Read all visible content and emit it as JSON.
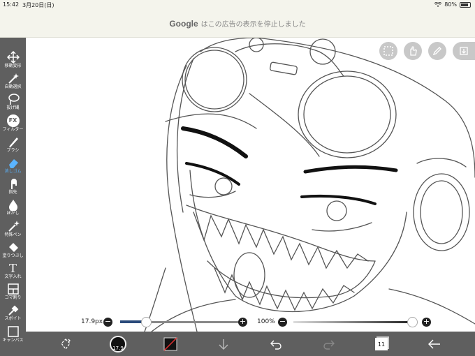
{
  "status_bar": {
    "time": "15:42",
    "date": "3月20日(日)",
    "battery": "80%",
    "battery_level": 0.8
  },
  "ad_banner": {
    "brand": "Google",
    "message": "はこの広告の表示を停止しました"
  },
  "tools": [
    {
      "id": "move",
      "label": "移動変形",
      "icon": "move-arrows-icon"
    },
    {
      "id": "auto-select",
      "label": "自動選択",
      "icon": "magic-wand-icon"
    },
    {
      "id": "lasso",
      "label": "投げ縄",
      "icon": "lasso-icon"
    },
    {
      "id": "filter",
      "label": "フィルター",
      "icon": "fx-icon",
      "glyph": "FX"
    },
    {
      "id": "brush",
      "label": "ブラシ",
      "icon": "brush-icon"
    },
    {
      "id": "eraser",
      "label": "消しゴム",
      "icon": "eraser-icon",
      "active": true
    },
    {
      "id": "smudge",
      "label": "指先",
      "icon": "finger-icon"
    },
    {
      "id": "blur",
      "label": "ぼかし",
      "icon": "drop-icon"
    },
    {
      "id": "special-pen",
      "label": "特殊ペン",
      "icon": "sparkle-pen-icon"
    },
    {
      "id": "fill",
      "label": "塗りつぶし",
      "icon": "bucket-icon"
    },
    {
      "id": "text",
      "label": "文字入れ",
      "icon": "text-icon",
      "glyph": "T"
    },
    {
      "id": "frame",
      "label": "コマ割り",
      "icon": "frame-icon"
    },
    {
      "id": "eyedropper",
      "label": "スポイト",
      "icon": "eyedropper-icon"
    },
    {
      "id": "canvas",
      "label": "キャンバス",
      "icon": "canvas-icon"
    }
  ],
  "top_buttons": [
    {
      "id": "selection",
      "icon": "selection-icon"
    },
    {
      "id": "hand",
      "icon": "hand-icon"
    },
    {
      "id": "pen",
      "icon": "pen-icon"
    },
    {
      "id": "menu",
      "icon": "down-arrow-icon"
    }
  ],
  "brush_size": {
    "value_label": "17.9px",
    "level": 0.22
  },
  "opacity": {
    "value_label": "100%",
    "level": 1.0
  },
  "bottom_toolbar": {
    "brush_preview_label": "17.9",
    "layers_count": "11"
  },
  "colors": {
    "toolbar_bg": "#5f5f5f",
    "accent": "#5ab4ff",
    "slider_fill": "#2a4a7a"
  }
}
